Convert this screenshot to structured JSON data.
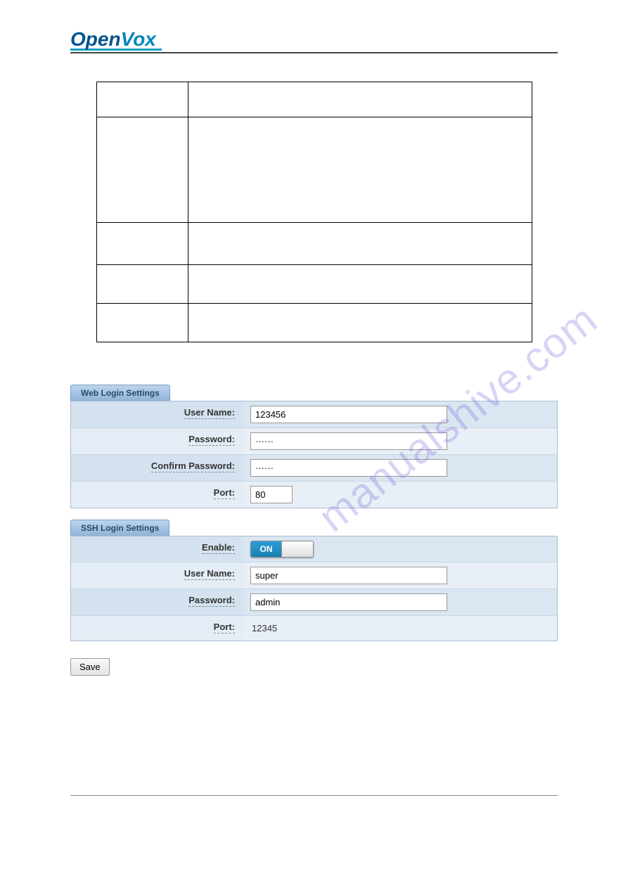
{
  "logo": {
    "part1": "Open",
    "part2": "Vox"
  },
  "watermark": "manualshive.com",
  "panels": {
    "web": {
      "title": "Web Login Settings",
      "username_label": "User Name:",
      "username_value": "123456",
      "password_label": "Password:",
      "password_value": "······",
      "confirm_label": "Confirm Password:",
      "confirm_value": "······",
      "port_label": "Port:",
      "port_value": "80"
    },
    "ssh": {
      "title": "SSH Login Settings",
      "enable_label": "Enable:",
      "enable_on": "ON",
      "username_label": "User Name:",
      "username_value": "super",
      "password_label": "Password:",
      "password_value": "admin",
      "port_label": "Port:",
      "port_value": "12345"
    }
  },
  "save_label": "Save"
}
